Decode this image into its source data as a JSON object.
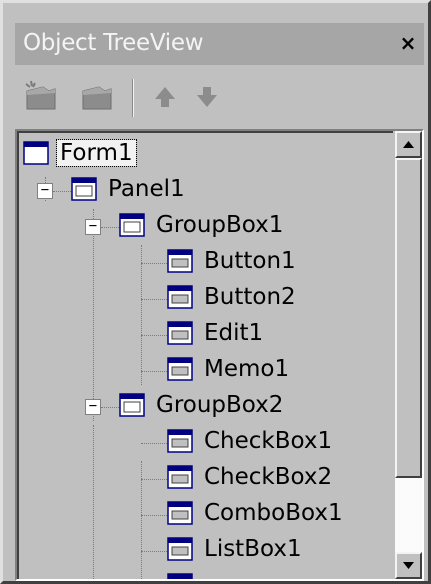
{
  "window": {
    "title": "Object TreeView",
    "close_glyph": "×"
  },
  "toolbar": {
    "buttons": [
      {
        "icon": "add-item-icon"
      },
      {
        "icon": "delete-item-icon"
      },
      {
        "icon": "move-up-icon"
      },
      {
        "icon": "move-down-icon"
      }
    ]
  },
  "tree": {
    "nodes": [
      {
        "label": "Form1",
        "depth": 0,
        "selected": true
      },
      {
        "label": "Panel1",
        "depth": 1,
        "expanded": true
      },
      {
        "label": "GroupBox1",
        "depth": 2,
        "expanded": true
      },
      {
        "label": "Button1",
        "depth": 3
      },
      {
        "label": "Button2",
        "depth": 3
      },
      {
        "label": "Edit1",
        "depth": 3
      },
      {
        "label": "Memo1",
        "depth": 3
      },
      {
        "label": "GroupBox2",
        "depth": 2,
        "expanded": true
      },
      {
        "label": "CheckBox1",
        "depth": 3
      },
      {
        "label": "CheckBox2",
        "depth": 3
      },
      {
        "label": "ComboBox1",
        "depth": 3
      },
      {
        "label": "ListBox1",
        "depth": 3
      }
    ],
    "expander_glyph": "−"
  },
  "scrollbar": {
    "up_icon": "scroll-up-arrow-icon",
    "down_icon": "scroll-down-arrow-icon"
  }
}
